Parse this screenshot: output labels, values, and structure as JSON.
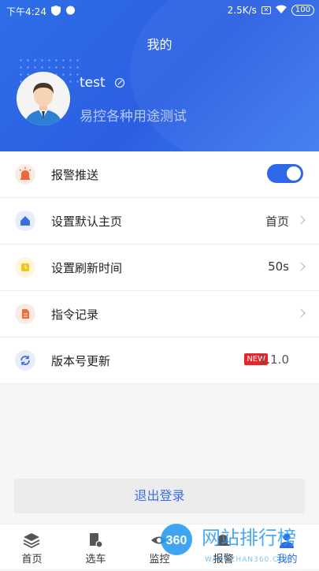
{
  "status": {
    "time": "下午4:24",
    "speed": "2.5K/s",
    "battery": "100"
  },
  "header": {
    "title": "我的",
    "username": "test",
    "subtitle": "易控各种用途测试"
  },
  "settings": [
    {
      "label": "报警推送",
      "icon": "alarm-icon",
      "icon_color": "#f0643c",
      "icon_bg": "#fdeae3",
      "toggle_on": true
    },
    {
      "label": "设置默认主页",
      "icon": "home-icon",
      "icon_color": "#3b6fe0",
      "icon_bg": "#e6eefc",
      "value": "首页"
    },
    {
      "label": "设置刷新时间",
      "icon": "clock-icon",
      "icon_color": "#f5c518",
      "icon_bg": "#fdf6dc",
      "value": "50s"
    },
    {
      "label": "指令记录",
      "icon": "document-icon",
      "icon_color": "#f26b3a",
      "icon_bg": "#fdebe3"
    },
    {
      "label": "版本号更新",
      "icon": "refresh-icon",
      "icon_color": "#3b6fe0",
      "icon_bg": "#e6eefc",
      "badge": "NEW",
      "value": "1.1.0"
    }
  ],
  "logout_label": "退出登录",
  "tabs": [
    {
      "label": "首页",
      "icon": "layers-icon"
    },
    {
      "label": "选车",
      "icon": "car-select-icon"
    },
    {
      "label": "监控",
      "icon": "eye-icon"
    },
    {
      "label": "报警",
      "icon": "bell-icon"
    },
    {
      "label": "我的",
      "icon": "user-icon"
    }
  ],
  "watermark": {
    "badge": "360",
    "text": "网站排行榜",
    "url": "WANGZHAN360.COM"
  },
  "colors": {
    "primary": "#2f68e8",
    "logout_text": "#3b6fe0",
    "new_badge": "#e5242b"
  }
}
